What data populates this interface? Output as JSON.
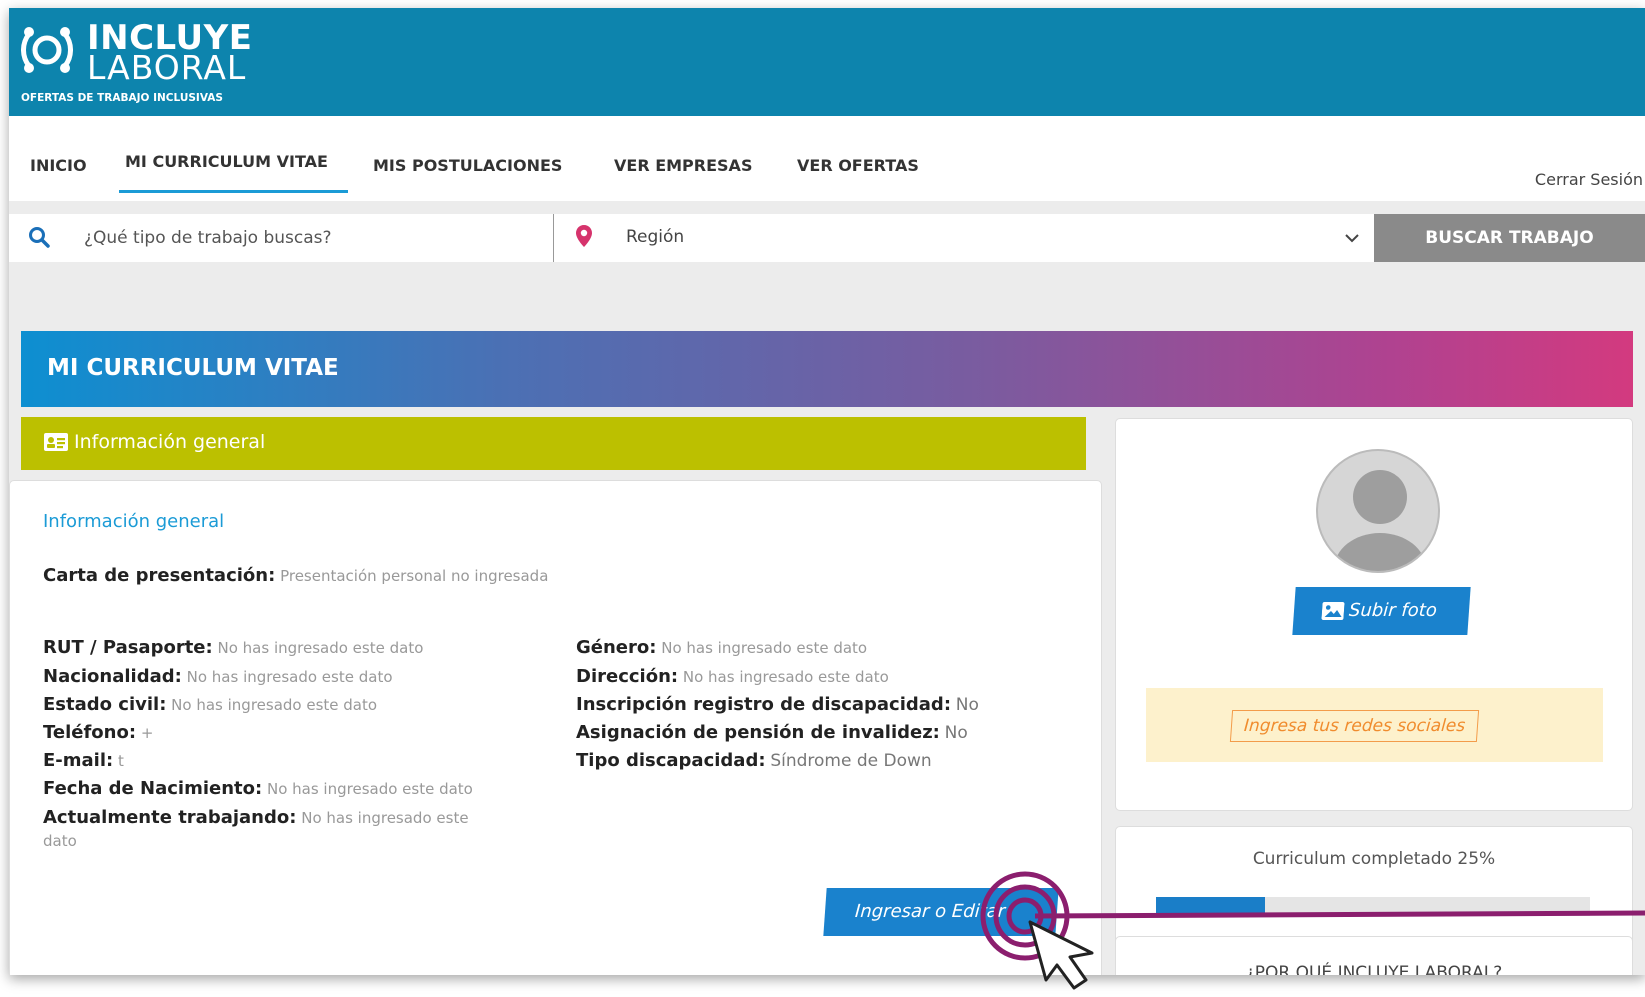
{
  "logo": {
    "title_line1": "INCLUYE",
    "title_line2": "LABORAL",
    "tagline": "OFERTAS DE TRABAJO INCLUSIVAS"
  },
  "nav": {
    "items": [
      "INICIO",
      "MI CURRICULUM VITAE",
      "MIS POSTULACIONES",
      "VER EMPRESAS",
      "VER OFERTAS"
    ],
    "active_index": 1,
    "logout": "Cerrar Sesión"
  },
  "search": {
    "placeholder": "¿Qué tipo de trabajo buscas?",
    "region_value": "Región",
    "button": "BUSCAR TRABAJO"
  },
  "page": {
    "title": "MI CURRICULUM VITAE",
    "section_label": "Información general"
  },
  "info": {
    "heading": "Información general",
    "cover_letter_label": "Carta de presentación:",
    "cover_letter_value": "Presentación personal no ingresada",
    "left_fields": [
      {
        "label": "RUT / Pasaporte:",
        "value": "No has ingresado este dato"
      },
      {
        "label": "Nacionalidad:",
        "value": "No has ingresado este dato"
      },
      {
        "label": "Estado civil:",
        "value": "No has ingresado este dato"
      },
      {
        "label": "Teléfono:",
        "value": "+"
      },
      {
        "label": "E-mail:",
        "value": "t"
      },
      {
        "label": "Fecha de Nacimiento:",
        "value": "No has ingresado este dato"
      },
      {
        "label": "Actualmente trabajando:",
        "value": "No has ingresado este",
        "value_cont": "dato"
      }
    ],
    "right_fields": [
      {
        "label": "Género:",
        "value": "No has ingresado este dato"
      },
      {
        "label": "Dirección:",
        "value": "No has ingresado este dato"
      },
      {
        "label": "Inscripción registro de discapacidad:",
        "value": "No"
      },
      {
        "label": "Asignación de pensión de invalidez:",
        "value": "No"
      },
      {
        "label": "Tipo discapacidad:",
        "value": "Síndrome de Down"
      }
    ],
    "edit_button": "Ingresar o Editar"
  },
  "profile": {
    "upload_button": "Subir foto",
    "social_link": "Ingresa tus redes sociales"
  },
  "progress": {
    "label": "Curriculum completado 25%",
    "percent": 25
  },
  "why": {
    "label": "¿POR QUÉ INCLUYE LABORAL?"
  },
  "colors": {
    "header_blue": "#0d84ad",
    "accent_blue": "#1a82cd",
    "section_green": "#bcc000",
    "highlight_magenta": "#8b1e6e"
  },
  "icons": [
    "logo-icon",
    "search-icon",
    "location-pin-icon",
    "chevron-down-icon",
    "id-card-icon",
    "avatar-icon",
    "image-icon",
    "cursor-pointer-icon",
    "click-ripple-icon"
  ]
}
